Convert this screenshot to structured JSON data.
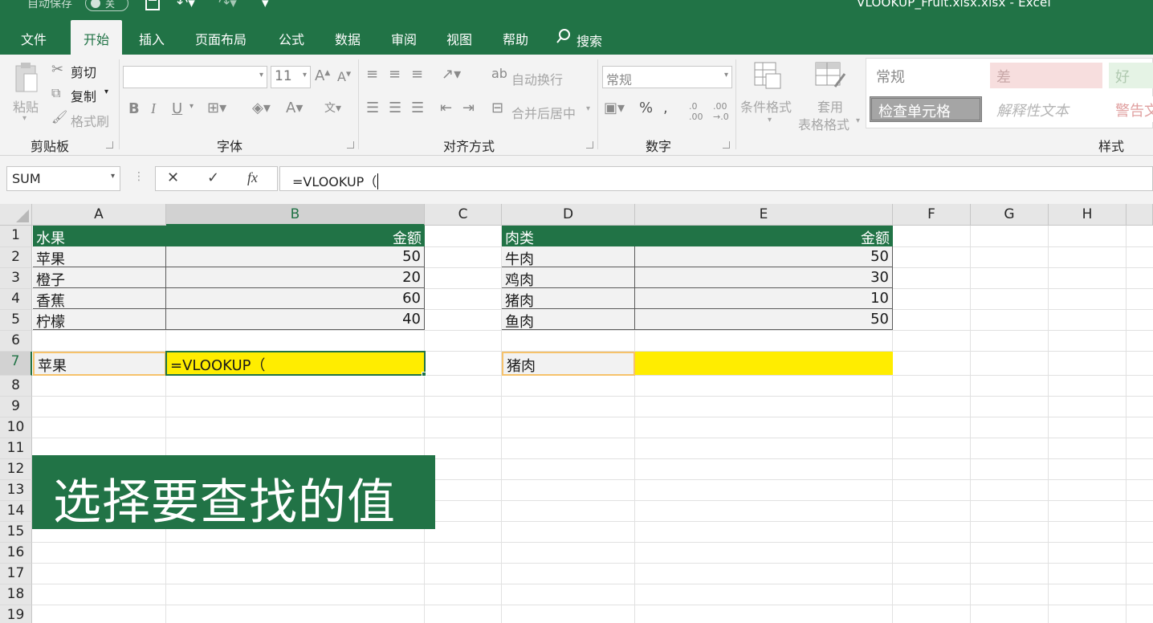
{
  "window": {
    "autosave_label": "自动保存",
    "autosave_state": "关",
    "doc_title": "VLOOKUP_Fruit.xlsx.xlsx  -  Excel"
  },
  "tabs": [
    "文件",
    "开始",
    "插入",
    "页面布局",
    "公式",
    "数据",
    "审阅",
    "视图",
    "帮助"
  ],
  "search_label": "搜索",
  "ribbon": {
    "clipboard": {
      "paste": "粘贴",
      "cut": "剪切",
      "copy": "复制",
      "format_painter": "格式刷",
      "label": "剪贴板"
    },
    "font": {
      "font_name": "",
      "font_size": "11",
      "bold": "B",
      "italic": "I",
      "underline": "U",
      "label": "字体"
    },
    "alignment": {
      "wrap_text": "自动换行",
      "merge_center": "合并后居中",
      "label": "对齐方式"
    },
    "number": {
      "format": "常规",
      "label": "数字"
    },
    "styles": {
      "conditional_format": "条件格式",
      "format_as_table_1": "套用",
      "format_as_table_2": "表格格式",
      "cells": [
        "常规",
        "差",
        "好",
        "检查单元格",
        "解释性文本",
        "警告文"
      ],
      "label": "样式"
    }
  },
  "formula_bar": {
    "name_box": "SUM",
    "cancel": "✕",
    "enter": "✓",
    "fx": "fx",
    "formula": "=VLOOKUP（"
  },
  "columns": [
    "A",
    "B",
    "C",
    "D",
    "E",
    "F",
    "G",
    "H"
  ],
  "rows": [
    "1",
    "2",
    "3",
    "4",
    "5",
    "6",
    "7",
    "8",
    "9",
    "10",
    "11",
    "12",
    "13",
    "14",
    "15",
    "16",
    "17",
    "18",
    "19"
  ],
  "fruit_table": {
    "header": [
      "水果",
      "金额"
    ],
    "rows": [
      [
        "苹果",
        "50"
      ],
      [
        "橙子",
        "20"
      ],
      [
        "香蕉",
        "60"
      ],
      [
        "柠檬",
        "40"
      ]
    ]
  },
  "meat_table": {
    "header": [
      "肉类",
      "金额"
    ],
    "rows": [
      [
        "牛肉",
        "50"
      ],
      [
        "鸡肉",
        "30"
      ],
      [
        "猪肉",
        "10"
      ],
      [
        "鱼肉",
        "50"
      ]
    ]
  },
  "lookup": {
    "a7": "苹果",
    "b7": "=VLOOKUP（",
    "d7": "猪肉",
    "e7": ""
  },
  "caption": "选择要查找的值",
  "colors": {
    "excel_green": "#217346",
    "highlight_yellow": "#ffed00",
    "lookup_border": "#f6c26b"
  }
}
